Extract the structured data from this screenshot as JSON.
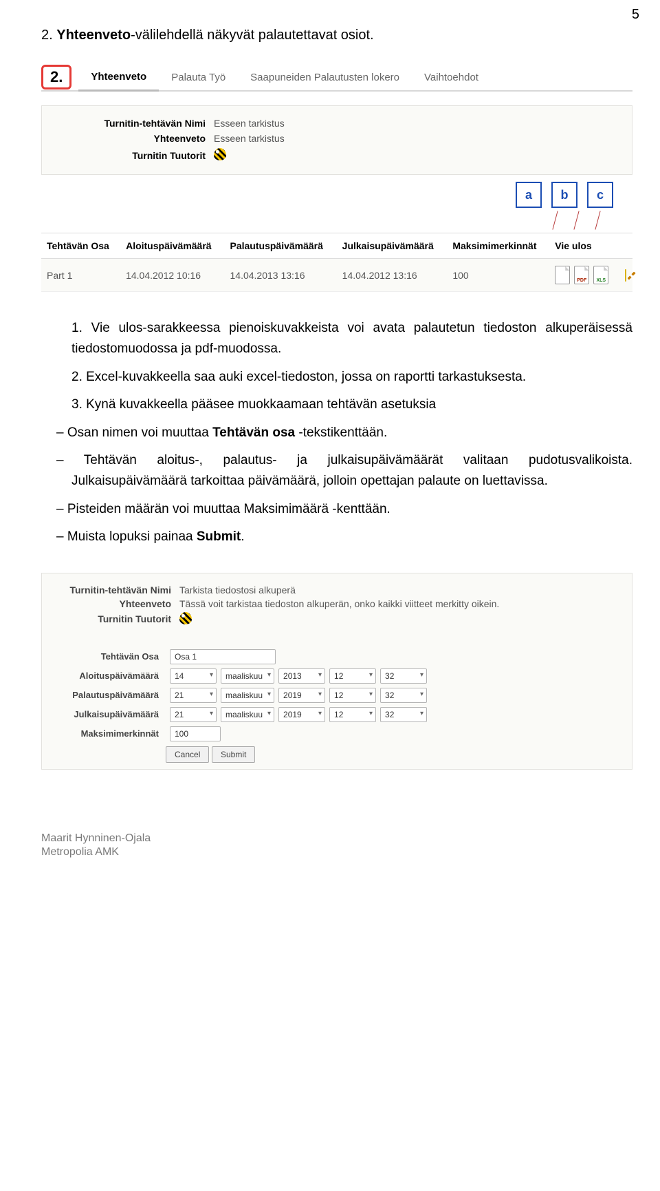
{
  "page_number": "5",
  "heading_num": "2.",
  "heading_text_bold": "Yhteenveto",
  "heading_text_rest": "-välilehdellä näkyvät palautettavat osiot.",
  "callout": "2.",
  "tabs": {
    "t1": "Yhteenveto",
    "t2": "Palauta Työ",
    "t3": "Saapuneiden Palautusten lokero",
    "t4": "Vaihtoehdot"
  },
  "info1": {
    "nimi_label": "Turnitin-tehtävän Nimi",
    "nimi_val": "Esseen tarkistus",
    "yht_label": "Yhteenveto",
    "yht_val": "Esseen tarkistus",
    "tut_label": "Turnitin Tuutorit"
  },
  "abc": {
    "a": "a",
    "b": "b",
    "c": "c"
  },
  "thead": {
    "c1": "Tehtävän Osa",
    "c2": "Aloituspäivämäärä",
    "c3": "Palautuspäivämäärä",
    "c4": "Julkaisupäivämäärä",
    "c5": "Maksimimerkinnät",
    "c6": "Vie ulos"
  },
  "trow": {
    "c1": "Part 1",
    "c2": "14.04.2012 10:16",
    "c3": "14.04.2013 13:16",
    "c4": "14.04.2012 13:16",
    "c5": "100",
    "pdf": "PDF",
    "xls": "XLS"
  },
  "body": {
    "p1": "1. Vie ulos-sarakkeessa pienoiskuvakkeista voi avata palautetun tiedoston alkuperäisessä tiedostomuodossa ja pdf-muodossa.",
    "p2": "2. Excel-kuvakkeella saa auki excel-tiedoston, jossa on raportti tarkastuksesta.",
    "p3": "3. Kynä kuvakkeella pääsee muokkaamaan tehtävän asetuksia",
    "s1a": "Osan nimen voi muuttaa ",
    "s1b": "Tehtävän osa",
    "s1c": " -tekstikenttään.",
    "s2": "Tehtävän aloitus-, palautus- ja julkaisupäivämäärät valitaan pudotusvalikoista. Julkaisupäivämäärä tarkoittaa päivämäärä, jolloin opettajan palaute on luettavissa.",
    "s3": "Pisteiden määrän voi muuttaa Maksimimäärä -kenttään.",
    "s4a": "Muista lopuksi painaa ",
    "s4b": "Submit",
    "s4c": "."
  },
  "ss2": {
    "nimi_label": "Turnitin-tehtävän Nimi",
    "nimi_val": "Tarkista tiedostosi alkuperä",
    "yht_label": "Yhteenveto",
    "yht_val": "Tässä voit tarkistaa tiedoston alkuperän, onko kaikki viitteet merkitty oikein.",
    "tut_label": "Turnitin Tuutorit",
    "osa_label": "Tehtävän Osa",
    "osa_val": "Osa 1",
    "a_label": "Aloituspäivämäärä",
    "a_d": "14",
    "a_m": "maaliskuu",
    "a_y": "2013",
    "a_h": "12",
    "a_min": "32",
    "p_label": "Palautuspäivämäärä",
    "p_d": "21",
    "p_m": "maaliskuu",
    "p_y": "2019",
    "p_h": "12",
    "p_min": "32",
    "j_label": "Julkaisupäivämäärä",
    "j_d": "21",
    "j_m": "maaliskuu",
    "j_y": "2019",
    "j_h": "12",
    "j_min": "32",
    "max_label": "Maksimimerkinnät",
    "max_val": "100",
    "cancel": "Cancel",
    "submit": "Submit"
  },
  "footer": {
    "l1": "Maarit Hynninen-Ojala",
    "l2": "Metropolia AMK"
  }
}
